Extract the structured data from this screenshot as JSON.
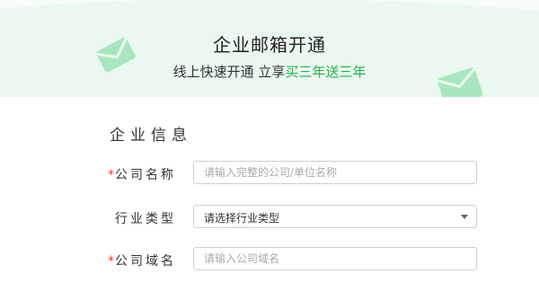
{
  "banner": {
    "title": "企业邮箱开通",
    "subtitle_prefix": "线上快速开通 立享",
    "subtitle_highlight": "买三年送三年",
    "colors": {
      "background": "#eaf8ef",
      "highlight": "#23b04e",
      "decoration": "#8fdcaa"
    }
  },
  "form": {
    "section_title": "企业信息",
    "required_mark": "*",
    "fields": {
      "company_name": {
        "label": "公司名称",
        "placeholder": "请输入完整的公司/单位名称"
      },
      "industry": {
        "label": "行业类型",
        "value": "请选择行业类型",
        "icon": "caret-down-icon"
      },
      "company_domain": {
        "label": "公司域名",
        "placeholder": "请输入公司域名"
      }
    }
  },
  "colors": {
    "required": "#e5342b",
    "border": "#cfcfcf"
  }
}
